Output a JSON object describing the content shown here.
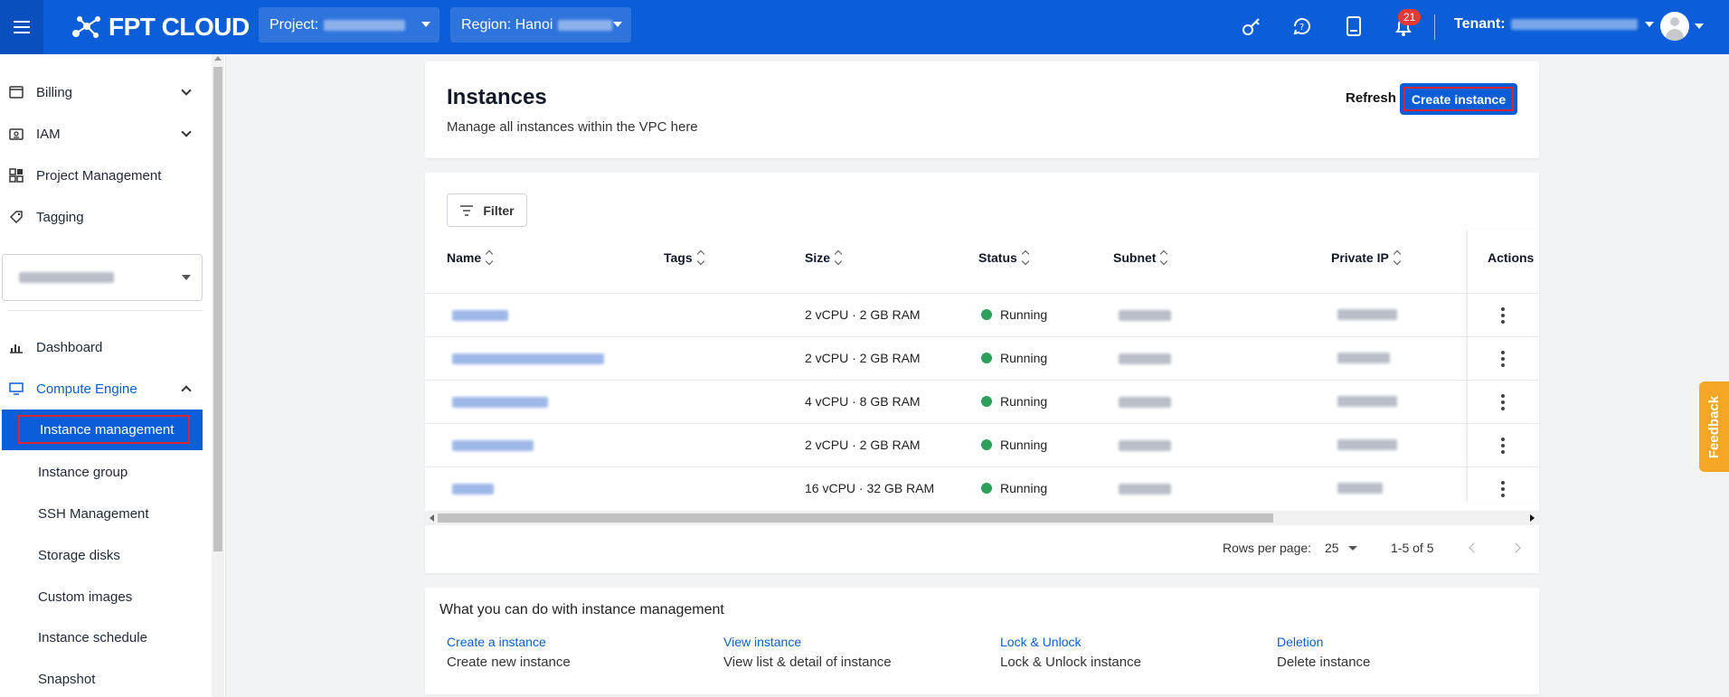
{
  "topbar": {
    "brand": "FPT CLOUD",
    "project_label": "Project:",
    "region_label": "Region: Hanoi",
    "notifications_count": "21",
    "tenant_label": "Tenant:"
  },
  "sidebar": {
    "items": [
      {
        "label": "Billing"
      },
      {
        "label": "IAM"
      },
      {
        "label": "Project Management"
      },
      {
        "label": "Tagging"
      }
    ],
    "dashboard_label": "Dashboard",
    "compute_label": "Compute Engine",
    "compute_items": [
      {
        "label": "Instance management"
      },
      {
        "label": "Instance group"
      },
      {
        "label": "SSH Management"
      },
      {
        "label": "Storage disks"
      },
      {
        "label": "Custom images"
      },
      {
        "label": "Instance schedule"
      },
      {
        "label": "Snapshot"
      }
    ]
  },
  "header": {
    "title": "Instances",
    "subtitle": "Manage all instances within the VPC here",
    "refresh_label": "Refresh",
    "create_label": "Create instance"
  },
  "table": {
    "filter_label": "Filter",
    "columns": [
      "Name",
      "Tags",
      "Size",
      "Status",
      "Subnet",
      "Private IP",
      "Actions"
    ],
    "rows": [
      {
        "size": "2 vCPU · 2 GB RAM",
        "status": "Running"
      },
      {
        "size": "2 vCPU · 2 GB RAM",
        "status": "Running"
      },
      {
        "size": "4 vCPU · 8 GB RAM",
        "status": "Running"
      },
      {
        "size": "2 vCPU · 2 GB RAM",
        "status": "Running"
      },
      {
        "size": "16 vCPU · 32 GB RAM",
        "status": "Running"
      }
    ],
    "rows_per_page_label": "Rows per page:",
    "rows_per_page_value": "25",
    "range_label": "1-5 of 5"
  },
  "help": {
    "title": "What you can do with instance management",
    "cards": [
      {
        "link": "Create a instance",
        "desc": "Create new instance"
      },
      {
        "link": "View instance",
        "desc": "View list & detail of instance"
      },
      {
        "link": "Lock & Unlock",
        "desc": "Lock & Unlock instance"
      },
      {
        "link": "Deletion",
        "desc": "Delete instance"
      }
    ]
  },
  "feedback_label": "Feedback",
  "colors": {
    "brand": "#0b5ed7",
    "running": "#2e9e5b",
    "feedback": "#f5a623",
    "highlight": "#d7262f"
  }
}
